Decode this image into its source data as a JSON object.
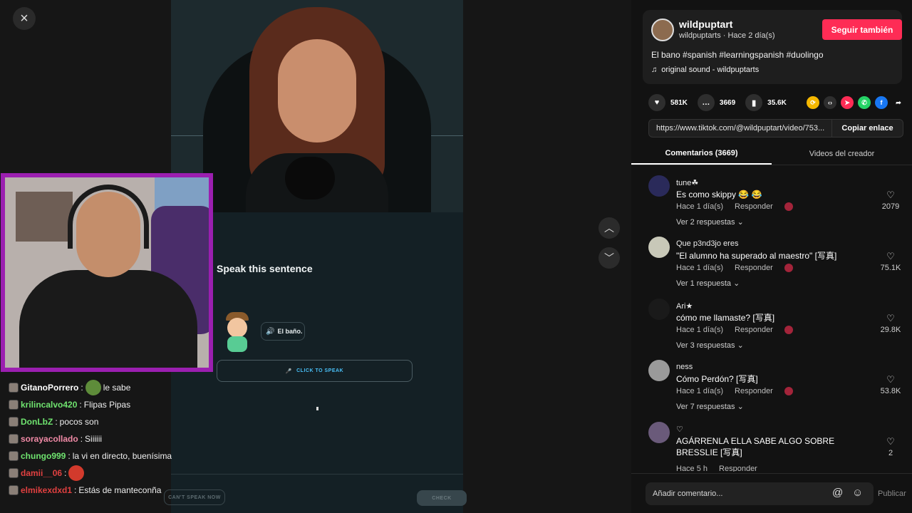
{
  "close_icon": "×",
  "duolingo": {
    "prompt": "Speak this sentence",
    "bubble_text": "El baño.",
    "click_to_speak": "CLICK TO SPEAK",
    "cant_speak": "CAN'T SPEAK NOW",
    "check": "CHECK"
  },
  "chat": [
    {
      "user": "GitanoPorrero",
      "color": "#ffffff",
      "text": "le sabe",
      "emote": true,
      "emote_color": "green"
    },
    {
      "user": "krilincalvo420",
      "color": "#6fe36f",
      "text": "Flipas Pipas"
    },
    {
      "user": "DonLbZ",
      "color": "#6fe36f",
      "text": "pocos son"
    },
    {
      "user": "sorayacollado",
      "color": "#f08aa6",
      "text": "Siiiiii"
    },
    {
      "user": "chungo999",
      "color": "#6fe36f",
      "text": "la vi en directo, buenísima"
    },
    {
      "user": "damii__06",
      "color": "#e04040",
      "text": "",
      "emote": true,
      "emote_color": "red"
    },
    {
      "user": "elmikexdxd1",
      "color": "#e04040",
      "text": "Estás de manteconña"
    }
  ],
  "creator": {
    "name": "wildpuptart",
    "meta": "wildpuptarts · Hace 2 día(s)",
    "follow_label": "Seguir también",
    "caption": "El bano #spanish #learningspanish #duolingo",
    "sound": "original sound - wildpuptarts"
  },
  "stats": {
    "likes": "581K",
    "comments": "3669",
    "saves": "35.6K"
  },
  "share_colors": [
    "#f5b800",
    "#2e2e2e",
    "#fe2c55",
    "#25d366",
    "#1877f2"
  ],
  "link": {
    "url": "https://www.tiktok.com/@wildpuptart/video/753...",
    "copy_label": "Copiar enlace"
  },
  "tabs": [
    {
      "label": "Comentarios (3669)"
    },
    {
      "label": "Videos del creador"
    }
  ],
  "comments": [
    {
      "user": "tune☘",
      "text": "Es como skippy 😂 😂",
      "time": "Hace 1 día(s)",
      "reply": "Responder",
      "replies": "Ver 2 respuestas ⌄",
      "likes": "2079",
      "avatar": "#2a2a5a"
    },
    {
      "user": "Que p3nd3jo eres",
      "text": "\"El alumno ha superado al maestro\" [写真]",
      "time": "Hace 1 día(s)",
      "reply": "Responder",
      "replies": "Ver 1 respuesta ⌄",
      "likes": "75.1K",
      "avatar": "#c8c8b8"
    },
    {
      "user": "Ari★",
      "text": "cómo me llamaste? [写真]",
      "time": "Hace 1 día(s)",
      "reply": "Responder",
      "replies": "Ver 3 respuestas ⌄",
      "likes": "29.8K",
      "avatar": "#1a1a1a"
    },
    {
      "user": "ness",
      "text": "Cómo Perdón? [写真]",
      "time": "Hace 1 día(s)",
      "reply": "Responder",
      "replies": "Ver 7 respuestas ⌄",
      "likes": "53.8K",
      "avatar": "#9a9a9a"
    },
    {
      "user": "♡",
      "text": "AGÁRRENLA ELLA SABE ALGO SOBRE BRESSLIE [写真]",
      "time": "Hace 5 h",
      "reply": "Responder",
      "replies": "",
      "likes": "2",
      "avatar": "#6a5a7a"
    }
  ],
  "comment_bar": {
    "placeholder": "Añadir comentario...",
    "publish": "Publicar"
  }
}
